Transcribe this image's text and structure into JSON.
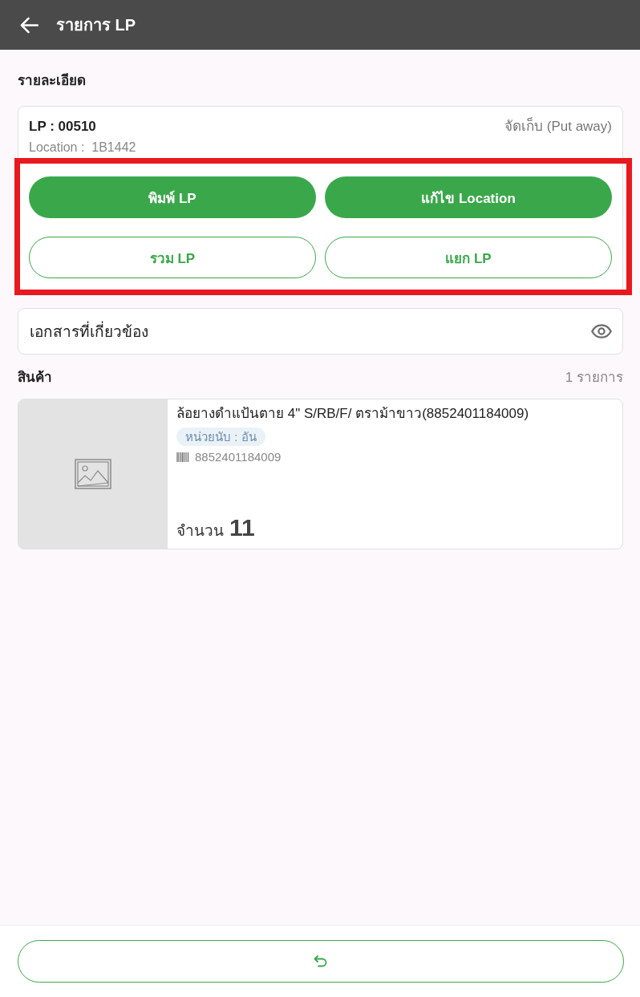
{
  "header": {
    "title": "รายการ LP"
  },
  "details": {
    "title": "รายละเอียด",
    "lp": "LP : 00510",
    "status": "จัดเก็บ (Put away)",
    "location": "Location :  1B1442"
  },
  "actions": {
    "highlighted": true,
    "buttons": [
      {
        "label": "พิมพ์ LP",
        "kind": "filled"
      },
      {
        "label": "แก้ไข Location",
        "kind": "filled"
      },
      {
        "label": "รวม LP",
        "kind": "outline"
      },
      {
        "label": "แยก LP",
        "kind": "outline"
      }
    ]
  },
  "documents": {
    "label": "เอกสารที่เกี่ยวข้อง"
  },
  "products": {
    "title": "สินค้า",
    "count": "1 รายการ",
    "items": [
      {
        "name": "ล้อยางดำแป้นตาย 4\" S/RB/F/ ตราม้าขาว(8852401184009)",
        "unit": "หน่วยนับ : อัน",
        "barcode": "8852401184009",
        "quantity_label": "จำนวน",
        "quantity": "11"
      }
    ]
  }
}
